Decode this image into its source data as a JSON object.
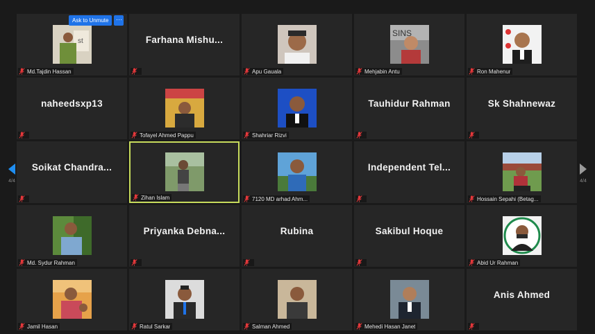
{
  "meeting": {
    "unmute_label": "Ask to Unmute",
    "more_label": "···",
    "page_indicator_left": "4/4",
    "page_indicator_right": "4/4",
    "active_speaker": "Zihan Islam"
  },
  "colors": {
    "tile_bg": "#262626",
    "page_bg": "#1a1a1a",
    "active_border": "#c7dc5c",
    "button_blue": "#1f73e8",
    "muted_red": "#e5383b",
    "arrow_left": "#1f8ef1",
    "arrow_right": "#9a9a9a"
  },
  "participants": [
    {
      "label": "Md.Tajdin Hassan",
      "display": "",
      "video": true
    },
    {
      "label": "",
      "display": "Farhana  Mishu...",
      "video": false
    },
    {
      "label": "Apu Gauala",
      "display": "",
      "video": true
    },
    {
      "label": "Mehjabin Antu",
      "display": "",
      "video": true
    },
    {
      "label": "Ron Mahenur",
      "display": "",
      "video": true
    },
    {
      "label": "",
      "display": "naheedsxp13",
      "video": false
    },
    {
      "label": "Tofayel Ahmed Pappu",
      "display": "",
      "video": true
    },
    {
      "label": "Shahriar Rizvi",
      "display": "",
      "video": true
    },
    {
      "label": "",
      "display": "Tauhidur Rahman",
      "video": false
    },
    {
      "label": "",
      "display": "Sk Shahnewaz",
      "video": false
    },
    {
      "label": "",
      "display": "Soikat  Chandra...",
      "video": false
    },
    {
      "label": "Zihan Islam",
      "display": "",
      "video": true
    },
    {
      "label": "7120  MD arhad Ahm...",
      "display": "",
      "video": true
    },
    {
      "label": "",
      "display": "Independent  Tel...",
      "video": false
    },
    {
      "label": "Hossain Sepahi (Betag...",
      "display": "",
      "video": true
    },
    {
      "label": "Md. Sydur Rahman",
      "display": "",
      "video": true
    },
    {
      "label": "",
      "display": "Priyanka  Debna...",
      "video": false
    },
    {
      "label": "",
      "display": "Rubina",
      "video": false
    },
    {
      "label": "",
      "display": "Sakibul Hoque",
      "video": false
    },
    {
      "label": "Abid Ur Rahman",
      "display": "",
      "video": true
    },
    {
      "label": "Jamil Hasan",
      "display": "",
      "video": true
    },
    {
      "label": "Ratul Sarkar",
      "display": "",
      "video": true
    },
    {
      "label": "Salman Ahmed",
      "display": "",
      "video": true
    },
    {
      "label": "Mehedi Hasan Janet",
      "display": "",
      "video": true
    },
    {
      "label": "",
      "display": "Anis Ahmed",
      "video": false
    }
  ]
}
